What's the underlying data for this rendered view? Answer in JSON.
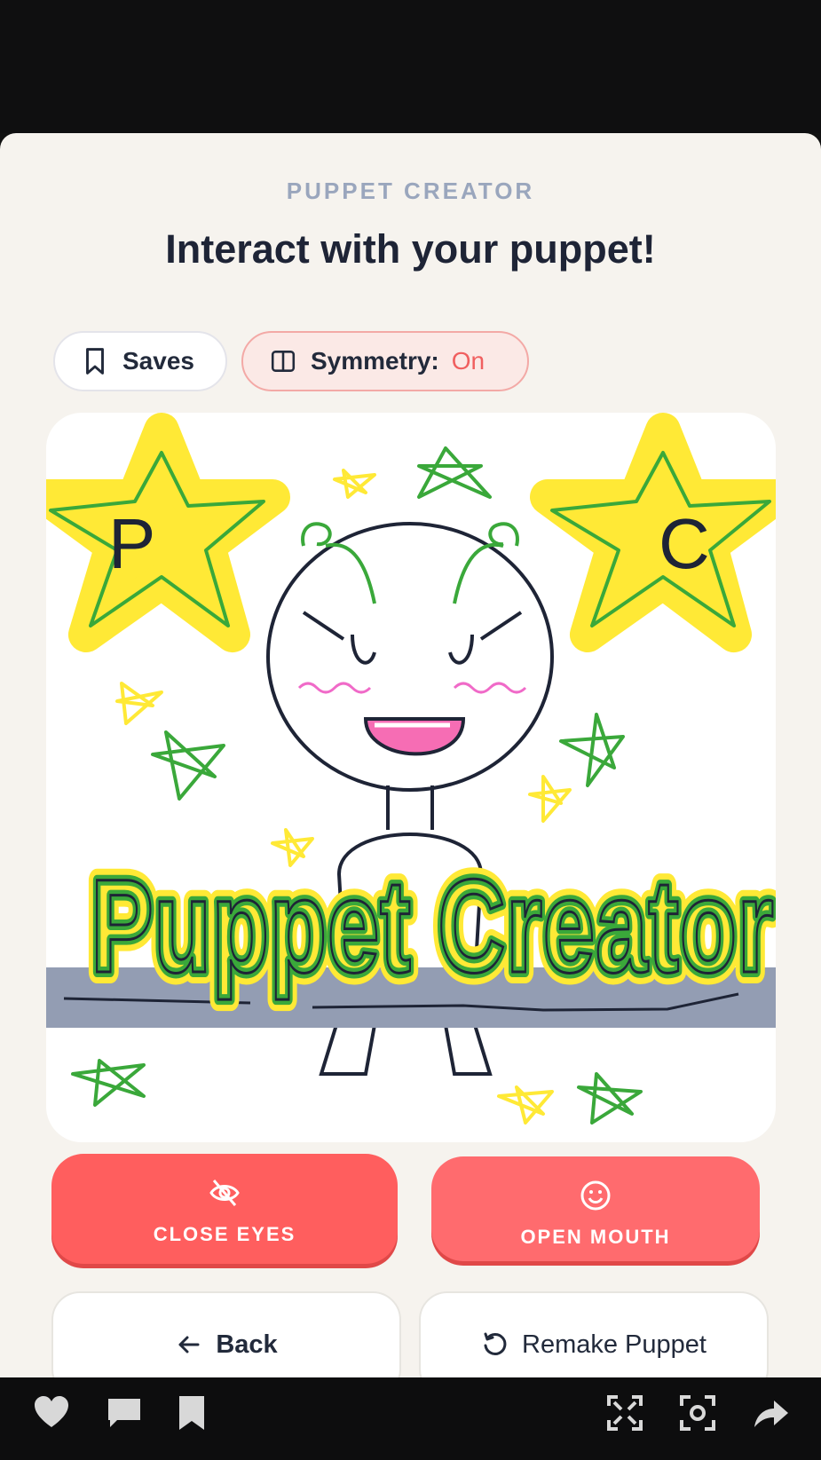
{
  "header": {
    "eyebrow": "PUPPET CREATOR",
    "title": "Interact with your puppet!"
  },
  "toolbar": {
    "saves_label": "Saves",
    "symmetry_label": "Symmetry:",
    "symmetry_value": "On",
    "bookmark_icon": "bookmark-icon",
    "symmetry_icon": "columns-icon"
  },
  "canvas": {
    "drawing_text": "Puppet Creator",
    "star_left_letter": "P",
    "star_right_letter": "C"
  },
  "actions": {
    "close_eyes": {
      "label": "CLOSE EYES",
      "icon": "eye-off-icon"
    },
    "open_mouth": {
      "label": "OPEN MOUTH",
      "icon": "smile-icon"
    }
  },
  "nav": {
    "back_label": "Back",
    "remake_label": "Remake Puppet"
  },
  "colors": {
    "accent": "#ff5e5e",
    "panel": "#f6f3ee",
    "text": "#1e2436",
    "muted": "#9aa6bd"
  },
  "system_bar": {
    "icons": [
      "heart-icon",
      "comment-icon",
      "bookmark-icon",
      "fullscreen-icon",
      "screenshot-icon",
      "share-icon"
    ]
  }
}
